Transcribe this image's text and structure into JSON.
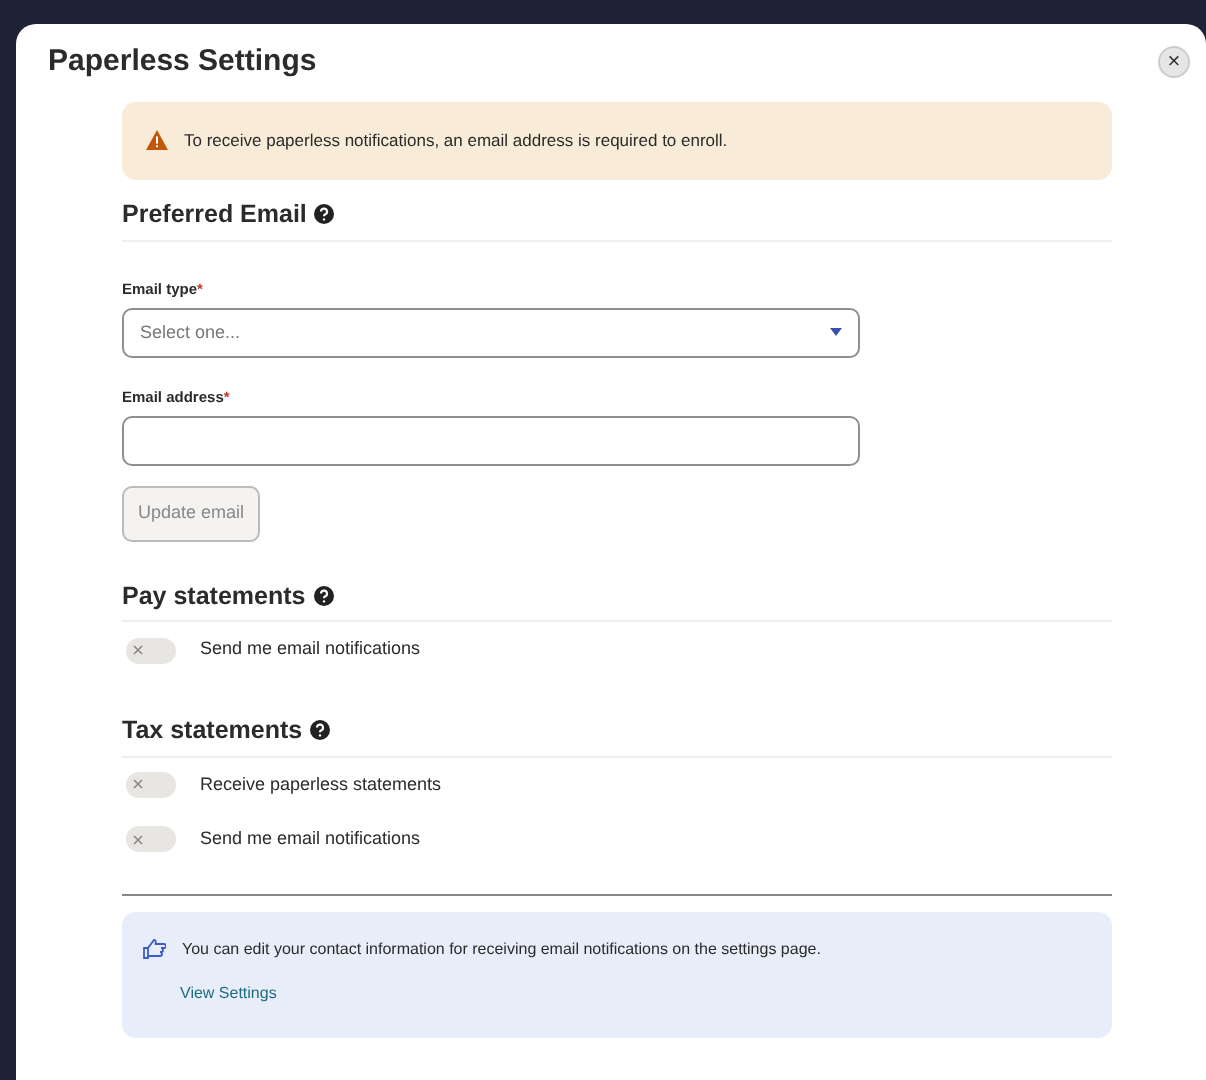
{
  "dialog": {
    "title": "Paperless Settings",
    "close": "×"
  },
  "alert": {
    "text": "To receive paperless notifications, an email address is required to enroll."
  },
  "preferred_email": {
    "heading": "Preferred Email",
    "fields": [
      {
        "kind": "select",
        "label": "Email type",
        "required_mark": "*",
        "placeholder": "Select one..."
      },
      {
        "kind": "text",
        "label": "Email address",
        "required_mark": "*"
      }
    ],
    "button": {
      "label": "Update email",
      "disabled": true
    }
  },
  "sections": [
    {
      "heading": "Pay statements",
      "toggles": [
        {
          "label": "Send me email notifications",
          "on": false
        }
      ]
    },
    {
      "heading": "Tax statements",
      "toggles": [
        {
          "label": "Receive paperless statements",
          "on": false
        },
        {
          "label": "Send me email notifications",
          "on": false
        }
      ]
    }
  ],
  "info": {
    "text": "You can edit your contact information for receiving email notifications on the settings page.",
    "link": "View Settings"
  }
}
